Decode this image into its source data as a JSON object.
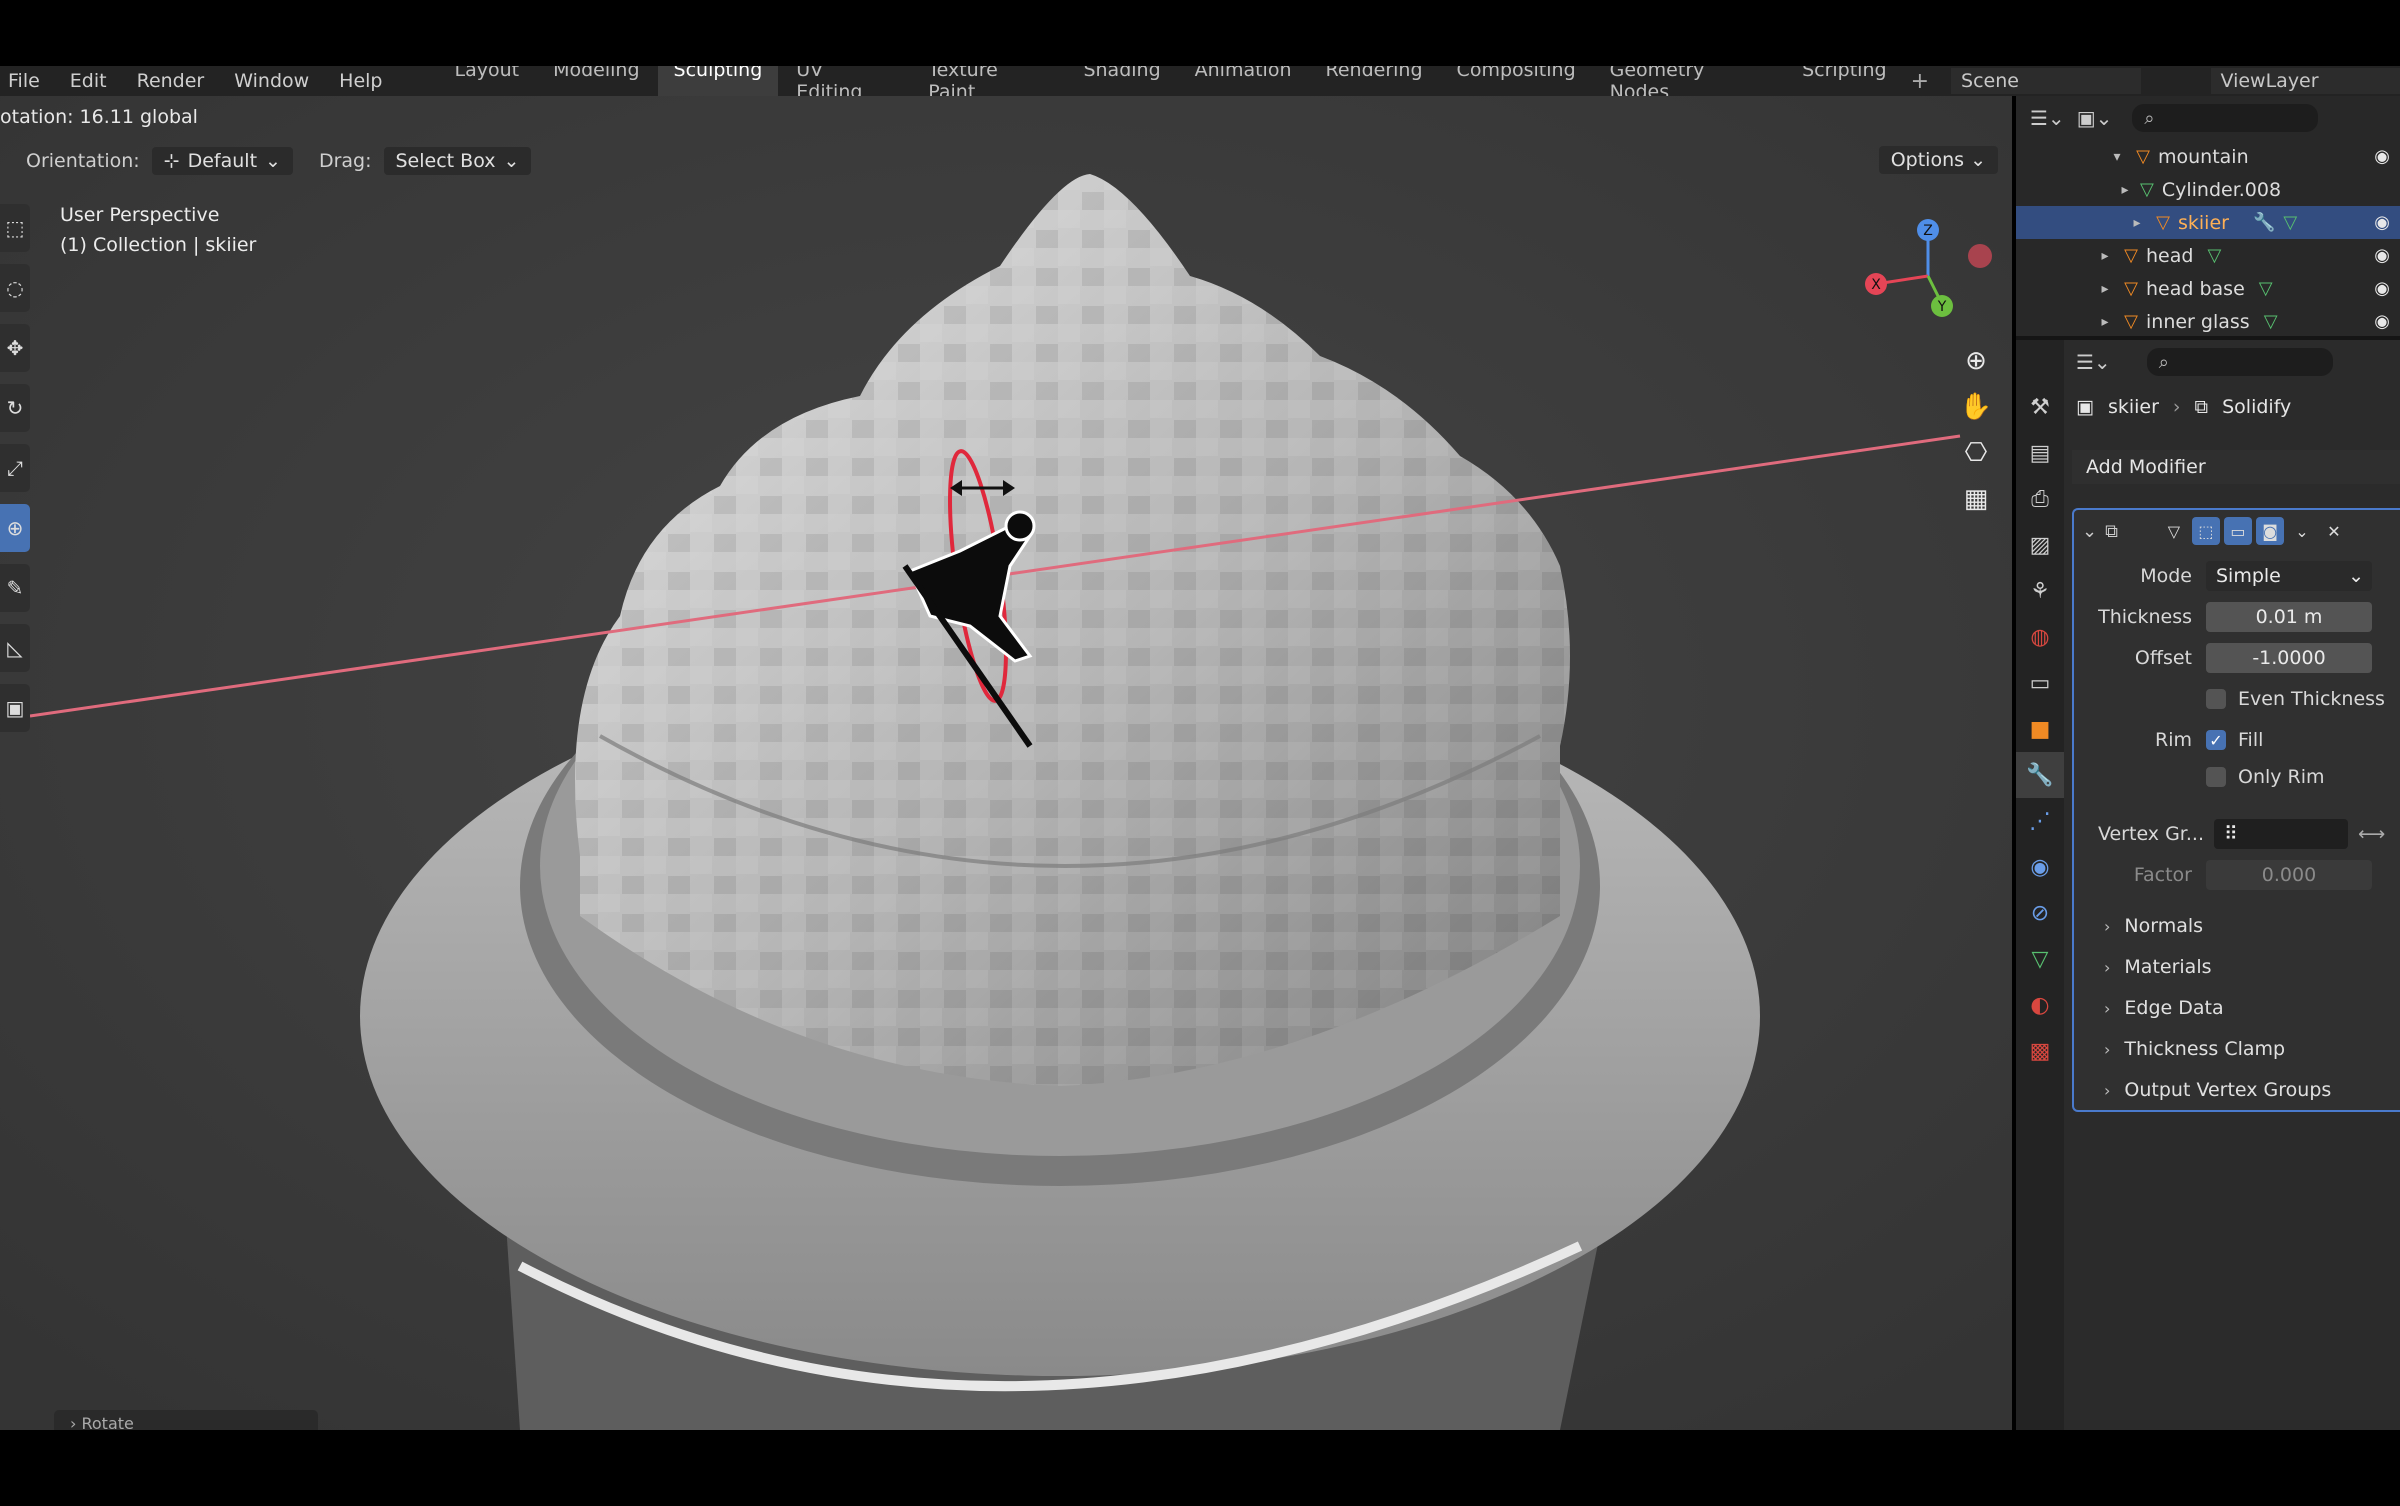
{
  "menu": [
    "File",
    "Edit",
    "Render",
    "Window",
    "Help"
  ],
  "workspaces": [
    {
      "label": "Layout",
      "active": false
    },
    {
      "label": "Modeling",
      "active": false
    },
    {
      "label": "Sculpting",
      "active": true
    },
    {
      "label": "UV Editing",
      "active": false
    },
    {
      "label": "Texture Paint",
      "active": false
    },
    {
      "label": "Shading",
      "active": false
    },
    {
      "label": "Animation",
      "active": false
    },
    {
      "label": "Rendering",
      "active": false
    },
    {
      "label": "Compositing",
      "active": false
    },
    {
      "label": "Geometry Nodes",
      "active": false
    },
    {
      "label": "Scripting",
      "active": false
    }
  ],
  "topbar": {
    "plus": "+",
    "scene": "Scene",
    "view_layer": "ViewLayer"
  },
  "viewport": {
    "op_status": "otation: 16.11 global",
    "orientation_label": "Orientation:",
    "orientation_value": "Default",
    "drag_label": "Drag:",
    "drag_value": "Select Box",
    "options_label": "Options",
    "view_name": "User Perspective",
    "collection_info": "(1) Collection | skiier",
    "rotate_panel": "Rotate",
    "gizmo": {
      "x": "X",
      "y": "Y",
      "z": "Z"
    }
  },
  "outliner": {
    "items": [
      {
        "name": "mountain",
        "level": 2,
        "expanded": true,
        "selected": false
      },
      {
        "name": "Cylinder.008",
        "level": 3,
        "selected": false
      },
      {
        "name": "skiier",
        "level": 3,
        "selected": true
      },
      {
        "name": "head",
        "level": 2,
        "selected": false
      },
      {
        "name": "head base",
        "level": 2,
        "selected": false
      },
      {
        "name": "inner glass",
        "level": 2,
        "selected": false
      }
    ]
  },
  "properties": {
    "object_name": "skiier",
    "modifier_name": "Solidify",
    "add_modifier": "Add Modifier",
    "mode_label": "Mode",
    "mode_value": "Simple",
    "thickness_label": "Thickness",
    "thickness_value": "0.01 m",
    "offset_label": "Offset",
    "offset_value": "-1.0000",
    "even_thickness": {
      "label": "Even Thickness",
      "checked": false
    },
    "rim_label": "Rim",
    "fill": {
      "label": "Fill",
      "checked": true
    },
    "only_rim": {
      "label": "Only Rim",
      "checked": false
    },
    "vertex_group_label": "Vertex Gr...",
    "factor_label": "Factor",
    "factor_value": "0.000",
    "subpanels": [
      "Normals",
      "Materials",
      "Edge Data",
      "Thickness Clamp",
      "Output Vertex Groups"
    ]
  },
  "colors": {
    "accent": "#4772b3",
    "selection": "#334d80",
    "object_orange": "#f08a24",
    "mesh_green": "#58c070"
  }
}
